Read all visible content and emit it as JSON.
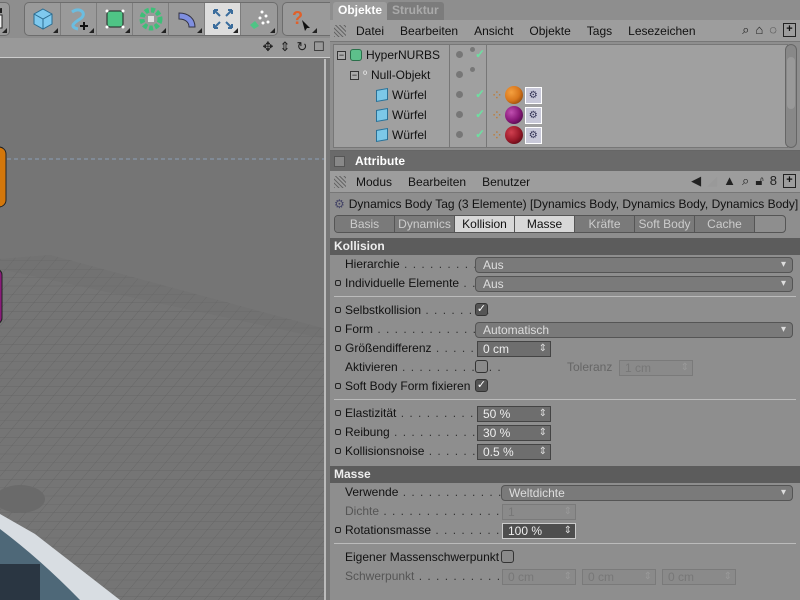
{
  "toolbar": {
    "buttons": [
      {
        "name": "clapper-icon"
      },
      {
        "name": "cube-icon"
      },
      {
        "name": "spline-icon"
      },
      {
        "name": "subdivision-icon"
      },
      {
        "name": "array-icon"
      },
      {
        "name": "deformer-icon"
      },
      {
        "name": "scene-icon"
      },
      {
        "name": "particle-icon"
      },
      {
        "name": "help-icon"
      }
    ]
  },
  "viewport": {
    "icons": [
      "move-icon",
      "zoom-icon",
      "rotate-icon",
      "maximize-icon"
    ]
  },
  "object_manager": {
    "tabs": [
      "Objekte",
      "Struktur"
    ],
    "menu": [
      "Datei",
      "Bearbeiten",
      "Ansicht",
      "Objekte",
      "Tags",
      "Lesezeichen"
    ],
    "tree": [
      {
        "name": "HyperNURBS",
        "depth": 0,
        "type": "hypernurbs",
        "check": true
      },
      {
        "name": "Null-Objekt",
        "depth": 1,
        "type": "null",
        "check": false
      },
      {
        "name": "Würfel",
        "depth": 2,
        "type": "cube",
        "check": true,
        "material": "#d9771c"
      },
      {
        "name": "Würfel",
        "depth": 2,
        "type": "cube",
        "check": true,
        "material": "#8a1a7a"
      },
      {
        "name": "Würfel",
        "depth": 2,
        "type": "cube",
        "check": true,
        "material": "#9b1a2a"
      }
    ]
  },
  "attributes": {
    "title": "Attribute",
    "menu": [
      "Modus",
      "Bearbeiten",
      "Benutzer"
    ],
    "object_name": "Dynamics Body Tag (3 Elemente) [Dynamics Body, Dynamics Body, Dynamics Body]",
    "tabs": [
      {
        "label": "Basis",
        "active": false
      },
      {
        "label": "Dynamics",
        "active": false
      },
      {
        "label": "Kollision",
        "active": true
      },
      {
        "label": "Masse",
        "active": true
      },
      {
        "label": "Kräfte",
        "active": false
      },
      {
        "label": "Soft Body",
        "active": false
      },
      {
        "label": "Cache",
        "active": false
      }
    ],
    "kollision": {
      "header": "Kollision",
      "hierarchie": {
        "label": "Hierarchie",
        "value": "Aus"
      },
      "individuelle": {
        "label": "Individuelle Elemente",
        "value": "Aus"
      },
      "selbstkollision": {
        "label": "Selbstkollision",
        "checked": true
      },
      "form": {
        "label": "Form",
        "value": "Automatisch"
      },
      "groessendifferenz": {
        "label": "Größendifferenz",
        "value": "0 cm"
      },
      "aktivieren": {
        "label": "Aktivieren",
        "checked": false
      },
      "toleranz": {
        "label": "Toleranz",
        "value": "1 cm"
      },
      "softbody_form": {
        "label": "Soft Body Form fixieren",
        "checked": true
      },
      "elastizitaet": {
        "label": "Elastizität",
        "value": "50 %"
      },
      "reibung": {
        "label": "Reibung",
        "value": "30 %"
      },
      "kollisionsnoise": {
        "label": "Kollisionsnoise",
        "value": "0.5 %"
      }
    },
    "masse": {
      "header": "Masse",
      "verwende": {
        "label": "Verwende",
        "value": "Weltdichte"
      },
      "dichte": {
        "label": "Dichte",
        "value": "1"
      },
      "rotationsmasse": {
        "label": "Rotationsmasse",
        "value": "100 %"
      },
      "eigener": {
        "label": "Eigener Massenschwerpunkt",
        "checked": false
      },
      "schwerpunkt": {
        "label": "Schwerpunkt",
        "x": "0 cm",
        "y": "0 cm",
        "z": "0 cm"
      }
    }
  }
}
